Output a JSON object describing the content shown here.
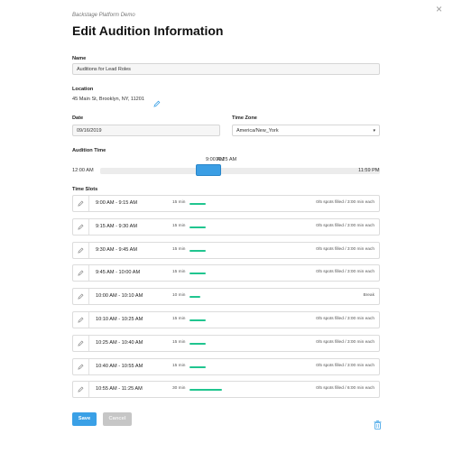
{
  "header": {
    "subtitle": "Backstage Platform Demo",
    "title": "Edit Audition Information",
    "close_glyph": "×"
  },
  "form": {
    "name_label": "Name",
    "name_value": "Auditions for Lead Roles",
    "location_label": "Location",
    "location_value": "45 Main St, Brooklyn, NY, 11201",
    "date_label": "Date",
    "date_value": "09/16/2019",
    "timezone_label": "Time Zone",
    "timezone_value": "America/New_York",
    "audition_time_label": "Audition Time",
    "range": {
      "min_label": "12:00 AM",
      "max_label": "11:59 PM",
      "start_label": "9:00 AM",
      "end_label": "11:25 AM"
    },
    "time_slots_label": "Time Slots"
  },
  "slots": [
    {
      "time": "9:00 AM - 9:15 AM",
      "duration": "15 min",
      "info": "0/5 spots filled / 3:00 min each"
    },
    {
      "time": "9:15 AM - 9:30 AM",
      "duration": "15 min",
      "info": "0/5 spots filled / 3:00 min each"
    },
    {
      "time": "9:30 AM - 9:45 AM",
      "duration": "15 min",
      "info": "0/5 spots filled / 3:00 min each"
    },
    {
      "time": "9:45 AM - 10:00 AM",
      "duration": "15 min",
      "info": "0/5 spots filled / 3:00 min each"
    },
    {
      "time": "10:00 AM - 10:10 AM",
      "duration": "10 min",
      "info": "Break"
    },
    {
      "time": "10:10 AM - 10:25 AM",
      "duration": "15 min",
      "info": "0/5 spots filled / 3:00 min each"
    },
    {
      "time": "10:25 AM - 10:40 AM",
      "duration": "15 min",
      "info": "0/5 spots filled / 3:00 min each"
    },
    {
      "time": "10:40 AM - 10:55 AM",
      "duration": "15 min",
      "info": "0/5 spots filled / 3:00 min each"
    },
    {
      "time": "10:55 AM - 11:25 AM",
      "duration": "30 min",
      "info": "0/5 spots filled / 6:00 min each"
    }
  ],
  "actions": {
    "save_label": "Save",
    "cancel_label": "Cancel"
  },
  "colors": {
    "accent": "#3aa0e6",
    "duration_bar": "#20c58f"
  }
}
